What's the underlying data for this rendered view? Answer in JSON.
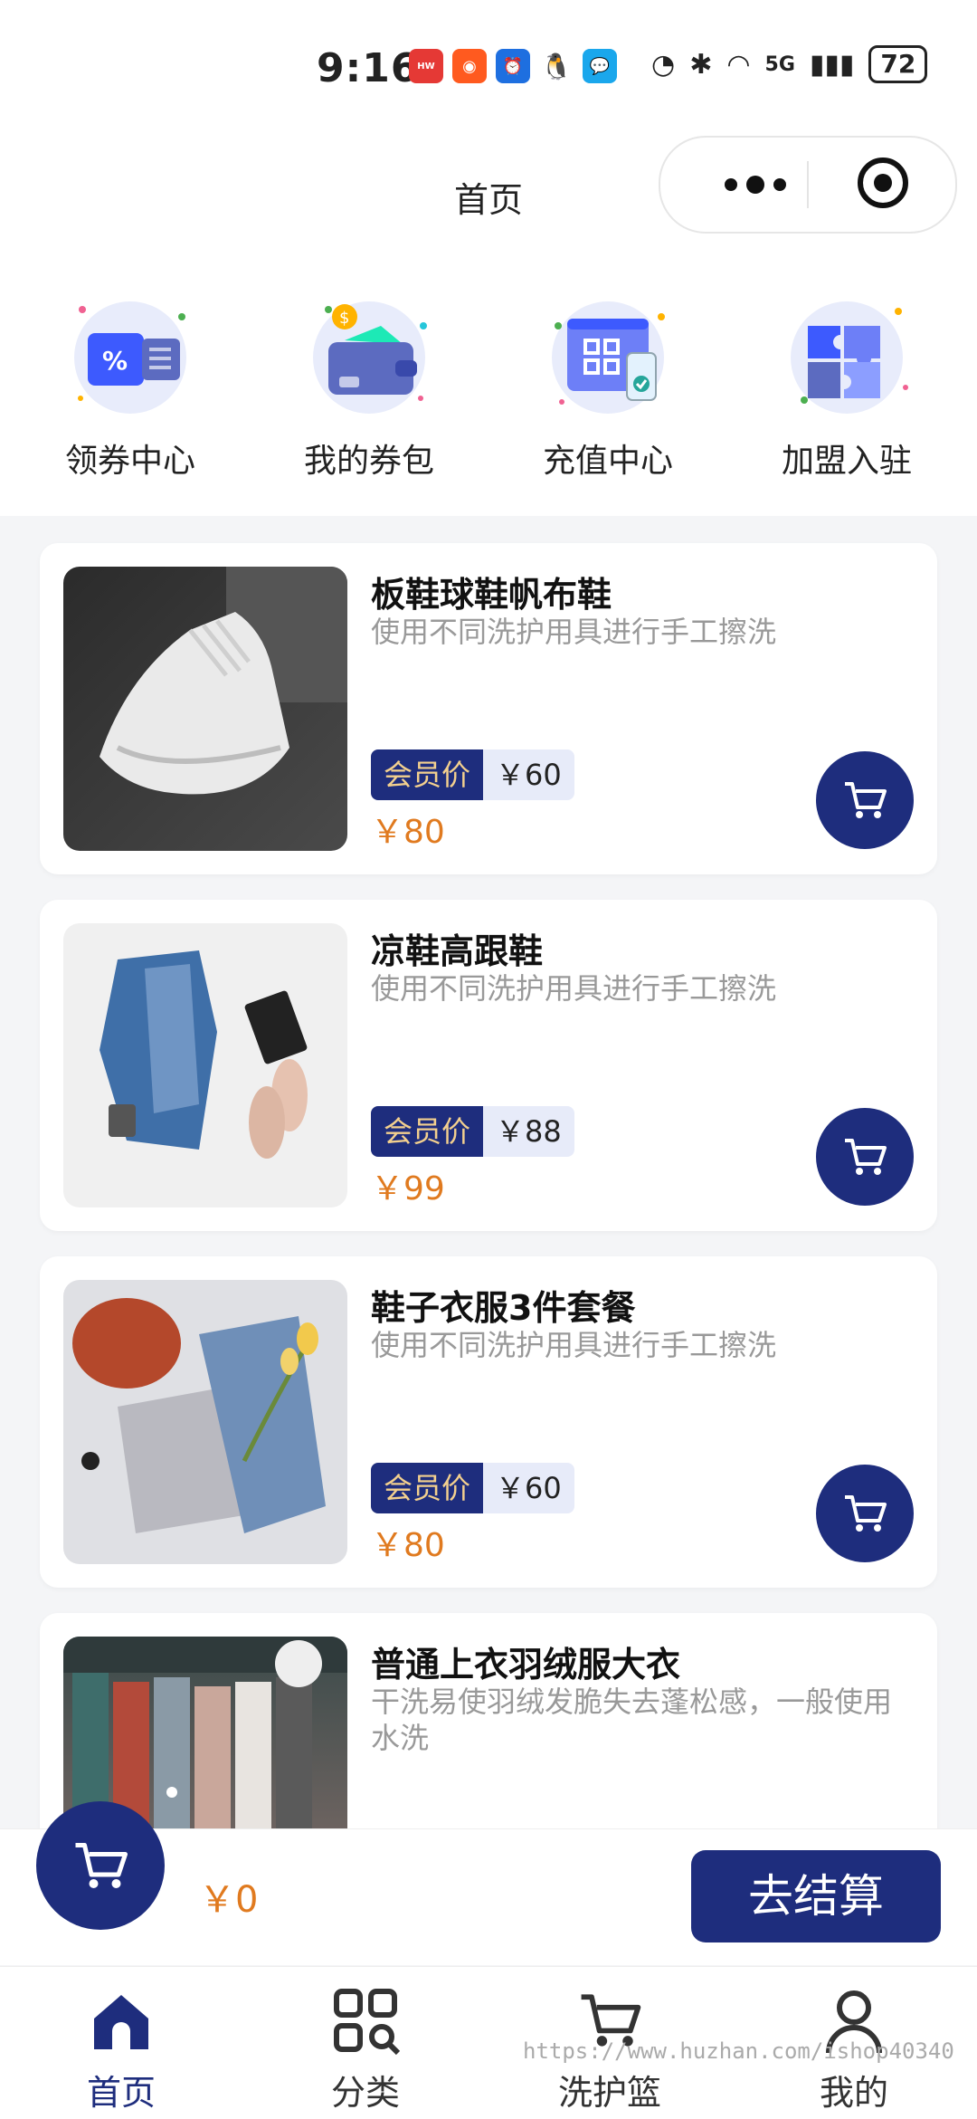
{
  "status_bar": {
    "time": "9:16",
    "network": "5G",
    "battery": "72",
    "app_icons": [
      "huawei-store-icon",
      "kuaishou-icon",
      "alarm-icon",
      "qq-icon",
      "message-icon"
    ]
  },
  "header": {
    "title": "首页"
  },
  "quick_menu": [
    {
      "label": "领券中心",
      "icon": "coupon-icon"
    },
    {
      "label": "我的券包",
      "icon": "wallet-icon"
    },
    {
      "label": "充值中心",
      "icon": "recharge-icon"
    },
    {
      "label": "加盟入驻",
      "icon": "puzzle-icon"
    }
  ],
  "products": [
    {
      "name": "板鞋球鞋帆布鞋",
      "desc": "使用不同洗护用具进行手工擦洗",
      "vip_tag": "会员价",
      "vip_price": "￥60",
      "price": "￥80"
    },
    {
      "name": "凉鞋高跟鞋",
      "desc": "使用不同洗护用具进行手工擦洗",
      "vip_tag": "会员价",
      "vip_price": "￥88",
      "price": "￥99"
    },
    {
      "name": "鞋子衣服3件套餐",
      "desc": "使用不同洗护用具进行手工擦洗",
      "vip_tag": "会员价",
      "vip_price": "￥60",
      "price": "￥80"
    },
    {
      "name": "普通上衣羽绒服大衣",
      "desc": "干洗易使羽绒发脆失去蓬松感，一般使用水洗",
      "vip_tag": "",
      "vip_price": "",
      "price": ""
    }
  ],
  "checkout": {
    "total": "￥0",
    "pay_label": "去结算"
  },
  "tabbar": [
    {
      "label": "首页",
      "icon": "home-icon",
      "active": true
    },
    {
      "label": "分类",
      "icon": "category-icon",
      "active": false
    },
    {
      "label": "洗护篮",
      "icon": "cart-icon",
      "active": false
    },
    {
      "label": "我的",
      "icon": "user-icon",
      "active": false
    }
  ],
  "watermark": "https://www.huzhan.com/ishop40340",
  "colors": {
    "accent": "#1e2d7d",
    "price": "#e07a1f",
    "vip_gold": "#f3d08e"
  }
}
